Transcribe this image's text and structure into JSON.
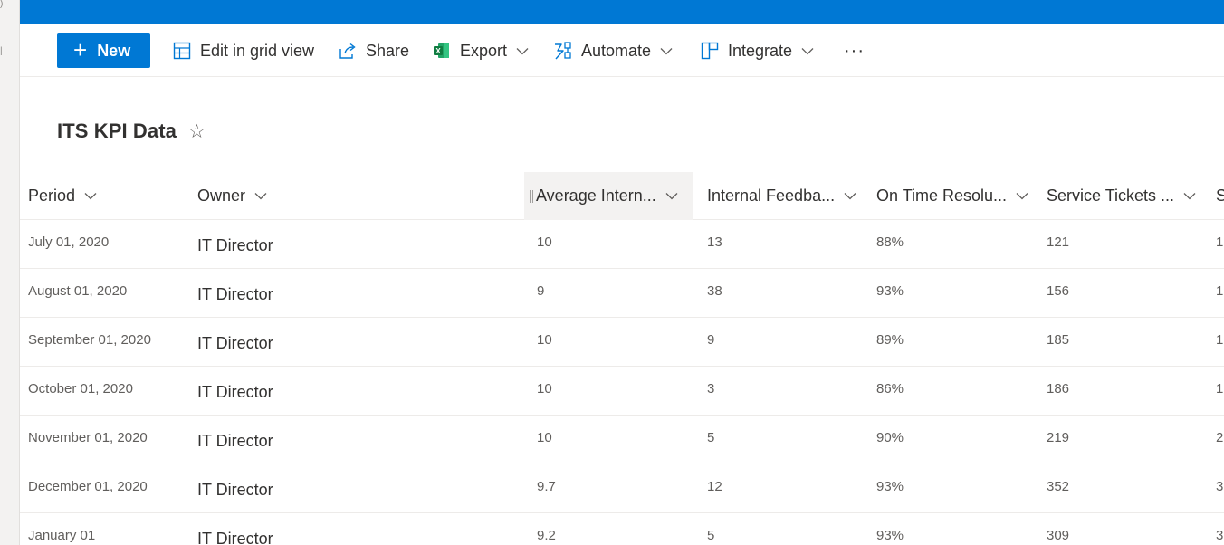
{
  "command_bar": {
    "new_label": "New",
    "edit_grid_label": "Edit in grid view",
    "share_label": "Share",
    "export_label": "Export",
    "automate_label": "Automate",
    "integrate_label": "Integrate",
    "more_label": "···"
  },
  "list": {
    "title": "ITS KPI Data",
    "favorite_icon": "☆"
  },
  "columns": [
    "Period",
    "Owner",
    "Average Intern...",
    "Internal Feedba...",
    "On Time Resolu...",
    "Service Tickets ...",
    "S"
  ],
  "rows": [
    {
      "period": "July 01, 2020",
      "owner": "IT Director",
      "avg_intern": "10",
      "internal_feedback": "13",
      "on_time": "88%",
      "service_tickets": "121",
      "next": "1"
    },
    {
      "period": "August 01, 2020",
      "owner": "IT Director",
      "avg_intern": "9",
      "internal_feedback": "38",
      "on_time": "93%",
      "service_tickets": "156",
      "next": "1"
    },
    {
      "period": "September 01, 2020",
      "owner": "IT Director",
      "avg_intern": "10",
      "internal_feedback": "9",
      "on_time": "89%",
      "service_tickets": "185",
      "next": "1"
    },
    {
      "period": "October 01, 2020",
      "owner": "IT Director",
      "avg_intern": "10",
      "internal_feedback": "3",
      "on_time": "86%",
      "service_tickets": "186",
      "next": "1"
    },
    {
      "period": "November 01, 2020",
      "owner": "IT Director",
      "avg_intern": "10",
      "internal_feedback": "5",
      "on_time": "90%",
      "service_tickets": "219",
      "next": "2"
    },
    {
      "period": "December 01, 2020",
      "owner": "IT Director",
      "avg_intern": "9.7",
      "internal_feedback": "12",
      "on_time": "93%",
      "service_tickets": "352",
      "next": "3"
    },
    {
      "period": "January 01",
      "owner": "IT Director",
      "avg_intern": "9.2",
      "internal_feedback": "5",
      "on_time": "93%",
      "service_tickets": "309",
      "next": "3"
    }
  ],
  "colors": {
    "brand": "#0078d4",
    "text_primary": "#323130",
    "text_secondary": "#605e5c",
    "excel_green": "#107c41"
  }
}
